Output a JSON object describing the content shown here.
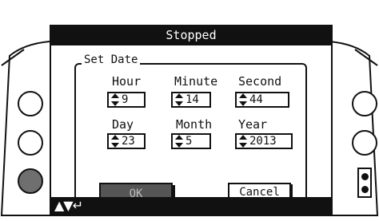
{
  "screen": {
    "title": "Stopped"
  },
  "set_date": {
    "group_label": "Set Date",
    "hour": {
      "label": "Hour",
      "value": "9"
    },
    "minute": {
      "label": "Minute",
      "value": "14"
    },
    "second": {
      "label": "Second",
      "value": "44"
    },
    "day": {
      "label": "Day",
      "value": "23"
    },
    "month": {
      "label": "Month",
      "value": "5"
    },
    "year": {
      "label": "Year",
      "value": "2013"
    }
  },
  "buttons": {
    "ok_label": "OK",
    "cancel_label": "Cancel"
  },
  "nav": {
    "glyphs": "▲▼↵"
  },
  "icons": [
    "spinner-icon",
    "nav-up-icon",
    "nav-down-icon",
    "enter-icon"
  ],
  "colors": {
    "bar": "#111111",
    "ok_button": "#555555",
    "dark_side_button": "#6f6f6f"
  }
}
